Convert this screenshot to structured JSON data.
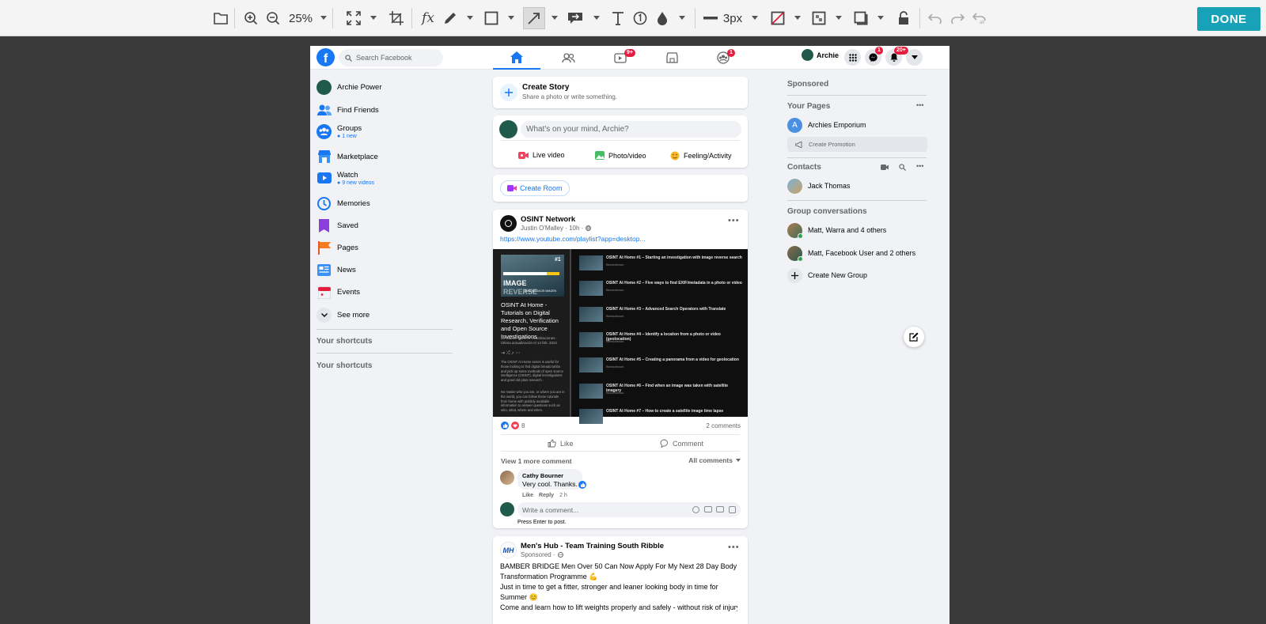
{
  "toolbar": {
    "zoom": "25%",
    "stroke": "3px",
    "done_label": "DONE"
  },
  "colors": {
    "accent": "#17a2b8",
    "fb_blue": "#1877f2",
    "badge_red": "#e41e3f"
  },
  "nav": {
    "search_placeholder": "Search Facebook",
    "watch_badge": "9+",
    "groups_badge": "1",
    "profile_name": "Archie",
    "messenger_badge": "1",
    "notif_badge": "20+"
  },
  "sidebar": {
    "items": [
      {
        "label": "Archie Power",
        "icon": "avatar"
      },
      {
        "label": "Find Friends",
        "icon": "friends-icon"
      },
      {
        "label": "Groups",
        "sub": "1 new",
        "icon": "groups-icon"
      },
      {
        "label": "Marketplace",
        "icon": "marketplace-icon"
      },
      {
        "label": "Watch",
        "sub": "9 new videos",
        "icon": "watch-icon"
      },
      {
        "label": "Memories",
        "icon": "memories-icon"
      },
      {
        "label": "Saved",
        "icon": "saved-icon"
      },
      {
        "label": "Pages",
        "icon": "pages-icon"
      },
      {
        "label": "News",
        "icon": "news-icon"
      },
      {
        "label": "Events",
        "icon": "events-icon"
      },
      {
        "label": "See more",
        "icon": "chevron-down-icon"
      }
    ],
    "shortcuts_1": "Your shortcuts",
    "shortcuts_2": "Your shortcuts"
  },
  "feed": {
    "create_story": {
      "title": "Create Story",
      "subtitle": "Share a photo or write something."
    },
    "composer": {
      "placeholder": "What's on your mind, Archie?",
      "live": "Live video",
      "photo": "Photo/video",
      "feeling": "Feeling/Activity"
    },
    "create_room": "Create Room",
    "post1": {
      "page": "OSINT Network",
      "author_line": "Justin O'Malley · 10h ·",
      "link": "https://www.youtube.com/playlist?app=desktop...",
      "playlist": {
        "badge": "#1",
        "thumb_text": "IMAGE",
        "thumb_text2": "REVERSE",
        "thumb_text3": "BÚSQUEDA DE IMAGEN",
        "title": "OSINT At Home - Tutorials on Digital Research, Verification and Open Source Investigations",
        "meta": "10 videos · 23.278 visualizaciones · Última actualización el 14 feb. 2022",
        "desc": "The OSINT At Home series is useful for those looking to find digital breadcrumbs and pick up some methods of open source intelligence (OSINT), digital investigations and good old plain research.",
        "desc2": "No matter who you are, or where you are in the world, you can follow these tutorials from home with publicly available information to answer questions such as who, what, where and when.",
        "items": [
          {
            "n": "1",
            "title": "OSINT At Home #1 – Starting an investigation with image reverse search",
            "channel": "Bendobrown",
            "dur": "10:29"
          },
          {
            "n": "2",
            "title": "OSINT At Home #2 – Five ways to find EXIF/metadata in a photo or video",
            "channel": "Bendobrown",
            "dur": ""
          },
          {
            "n": "3",
            "title": "OSINT At Home #3 – Advanced Search Operators with Translate",
            "channel": "Bendobrown",
            "dur": ""
          },
          {
            "n": "4",
            "title": "OSINT At Home #4 – Identify a location from a photo or video (geolocation)",
            "channel": "Bendobrown",
            "dur": ""
          },
          {
            "n": "5",
            "title": "OSINT At Home #5 – Creating a panorama from a video for geolocation",
            "channel": "Bendobrown",
            "dur": ""
          },
          {
            "n": "6",
            "title": "OSINT At Home #6 – Find when an image was taken with satellite imagery",
            "channel": "Bendobrown",
            "dur": ""
          },
          {
            "n": "7",
            "title": "OSINT At Home #7 – How to create a satellite image time lapse",
            "channel": "",
            "dur": ""
          }
        ]
      },
      "reactions": "8",
      "comments_count": "2 comments",
      "like": "Like",
      "comment": "Comment",
      "view_more": "View 1 more comment",
      "all_comments": "All comments",
      "top_comment": {
        "author": "Cathy Bourner",
        "text": "Very cool. Thanks.",
        "like": "Like",
        "reply": "Reply",
        "time": "2 h"
      },
      "write_placeholder": "Write a comment...",
      "press_enter": "Press Enter to post."
    },
    "post2": {
      "page": "Men's Hub - Team Training South Ribble",
      "sponsored": "Sponsored ·",
      "line1": "BAMBER BRIDGE Men Over 50 Can Now Apply For My Next 28 Day Body Transformation Programme 💪",
      "line2": "Just in time to get a fitter, stronger and leaner looking body in time for Summer 😊",
      "line3": "Come and learn how to lift weights properly and safely - without risk of injury...."
    }
  },
  "right": {
    "sponsored": "Sponsored",
    "your_pages": "Your Pages",
    "page_name": "Archies Emporium",
    "page_initial": "A",
    "create_promotion": "Create Promotion",
    "contacts": "Contacts",
    "contact1": "Jack Thomas",
    "group_conv": "Group conversations",
    "group1": "Matt, Warra and 4 others",
    "group2": "Matt, Facebook User and 2 others",
    "create_group": "Create New Group"
  }
}
